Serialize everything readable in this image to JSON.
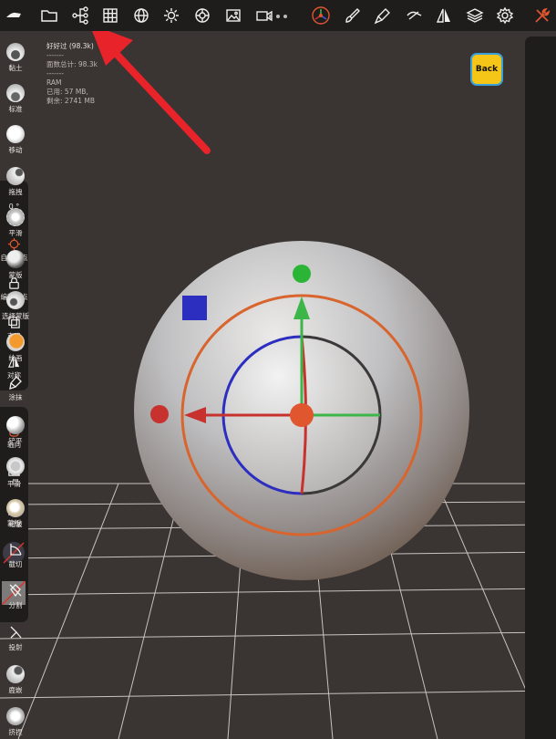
{
  "stats": {
    "title": "好好过 (98.3k)",
    "divider1": "-------",
    "faces_total": "面数总计:  98.3k",
    "divider2": "-------",
    "ram_label": "RAM",
    "used": "已用:  57 MB,",
    "remaining": "剩余:  2741 MB"
  },
  "back_label": "Back",
  "left_panel": {
    "angle": "0 °",
    "items": [
      "自动原点",
      "编辑原点",
      "克隆",
      "对称"
    ],
    "items2": [
      "轴向",
      "平滑",
      "蒙版"
    ]
  },
  "right_panel": {
    "items": [
      "黏土",
      "标准",
      "移动",
      "拖拽",
      "平滑",
      "蒙版",
      "选择蒙版",
      "绘画",
      "涂抹",
      "铲平",
      "层",
      "褶皱",
      "截切",
      "分割",
      "投射",
      "鹿嵌",
      "挤捏"
    ]
  },
  "toolbar": {
    "icons": [
      "sculpt-logo-icon",
      "folder-icon",
      "scene-tree-icon",
      "grid-icon",
      "globe-icon",
      "sun-icon",
      "material-icon",
      "image-icon",
      "camera-icon",
      "gizmo-icon",
      "brush-icon",
      "tools-icon",
      "stroke-icon",
      "symmetry-icon",
      "layers-icon",
      "settings-icon",
      "wrench-icon"
    ]
  },
  "colors": {
    "accent_orange": "#e0562f",
    "axis_red": "#c8322e",
    "axis_green": "#3cb648",
    "axis_blue": "#2c2ec0",
    "back_yellow": "#f5c518",
    "annotation_arrow": "#e8232a"
  }
}
